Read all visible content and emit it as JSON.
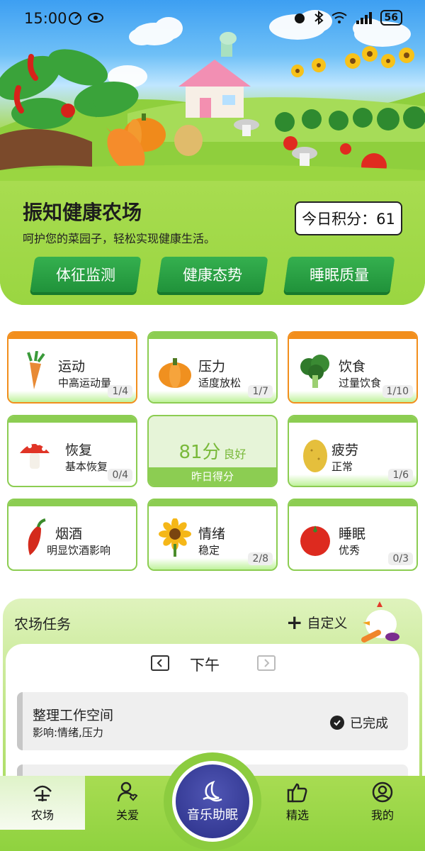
{
  "status_bar": {
    "time": "15:00",
    "battery": "56"
  },
  "hero": {
    "title": "振知健康农场",
    "subtitle": "呵护您的菜园子，轻松实现健康生活。",
    "score_label": "今日积分：61",
    "buttons": [
      "体征监测",
      "健康态势",
      "睡眠质量"
    ]
  },
  "cards": [
    {
      "title": "运动",
      "sub": "中高运动量",
      "badge": "1/4",
      "accent": "#f28e1c",
      "icon": "carrot-icon"
    },
    {
      "title": "压力",
      "sub": "适度放松",
      "badge": "1/7",
      "accent": "#8ccd52",
      "icon": "pumpkin-icon"
    },
    {
      "title": "饮食",
      "sub": "过量饮食",
      "badge": "1/10",
      "accent": "#f28e1c",
      "icon": "broccoli-icon"
    },
    {
      "title": "恢复",
      "sub": "基本恢复",
      "badge": "0/4",
      "accent": "#8ccd52",
      "icon": "mushroom-icon"
    },
    {
      "title": "疲劳",
      "sub": "正常",
      "badge": "1/6",
      "accent": "#8ccd52",
      "icon": "potato-icon"
    },
    {
      "title": "烟酒",
      "sub": "明显饮酒影响",
      "badge": "",
      "accent": "#8ccd52",
      "icon": "chili-icon"
    },
    {
      "title": "情绪",
      "sub": "稳定",
      "badge": "2/8",
      "accent": "#8ccd52",
      "icon": "sunflower-icon"
    },
    {
      "title": "睡眠",
      "sub": "优秀",
      "badge": "0/3",
      "accent": "#8ccd52",
      "icon": "tomato-icon"
    }
  ],
  "score_card": {
    "value": "81分",
    "level": "良好",
    "label": "昨日得分"
  },
  "tasks": {
    "title": "农场任务",
    "custom_label": "自定义",
    "period": "下午",
    "items": [
      {
        "name": "整理工作空间",
        "impact": "影响:情绪,压力",
        "status": "已完成"
      }
    ]
  },
  "nav": {
    "items": [
      {
        "label": "农场",
        "icon": "farm-icon"
      },
      {
        "label": "关爱",
        "icon": "care-icon"
      },
      {
        "label": "精选",
        "icon": "thumbs-up-icon"
      },
      {
        "label": "我的",
        "icon": "profile-icon"
      }
    ],
    "fab_label": "音乐助眠"
  }
}
